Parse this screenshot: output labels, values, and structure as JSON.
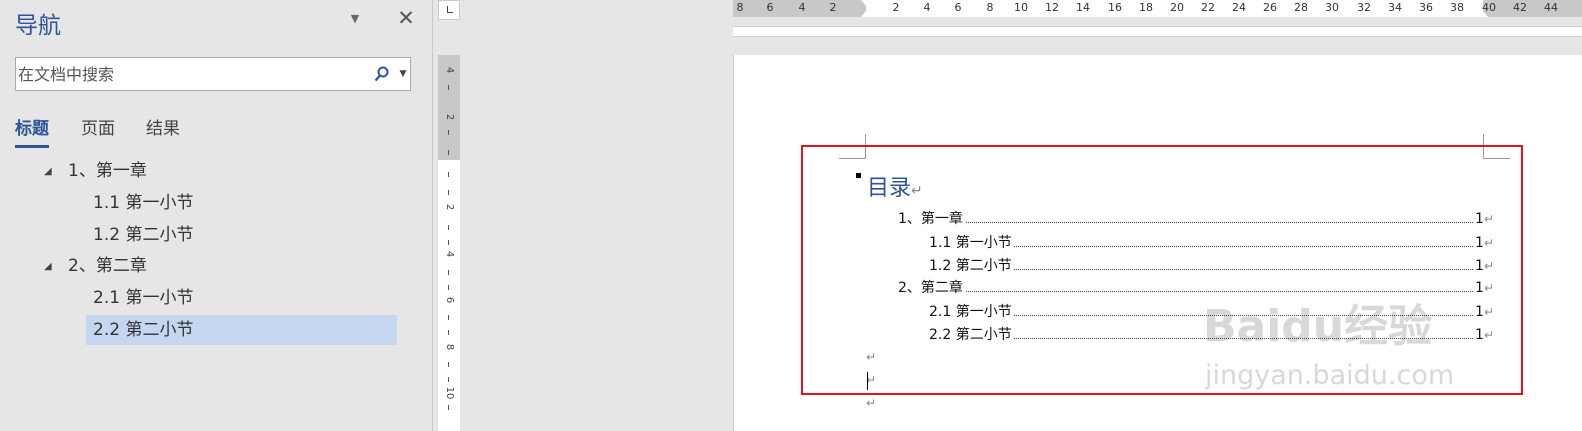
{
  "nav": {
    "title": "导航",
    "search_placeholder": "在文档中搜索",
    "tabs": [
      {
        "label": "标题"
      },
      {
        "label": "页面"
      },
      {
        "label": "结果"
      }
    ],
    "tree": [
      {
        "label": "1、第一章"
      },
      {
        "label": "1.1 第一小节"
      },
      {
        "label": "1.2 第二小节"
      },
      {
        "label": "2、第二章"
      },
      {
        "label": "2.1 第一小节"
      },
      {
        "label": "2.2 第二小节"
      }
    ]
  },
  "ruler": {
    "h_numbers": [
      "8",
      "6",
      "4",
      "2",
      "2",
      "4",
      "6",
      "8",
      "10",
      "12",
      "14",
      "16",
      "18",
      "20",
      "22",
      "24",
      "26",
      "28",
      "30",
      "32",
      "34",
      "36",
      "38",
      "40",
      "42",
      "44"
    ],
    "v_numbers": [
      "4",
      "2",
      "2",
      "4",
      "6",
      "8",
      "10"
    ]
  },
  "document": {
    "toc_title": "目录",
    "toc": [
      {
        "text": "1、第一章",
        "page": "1"
      },
      {
        "text": "1.1  第一小节",
        "page": "1"
      },
      {
        "text": "1.2  第二小节",
        "page": "1"
      },
      {
        "text": "2、第二章",
        "page": "1"
      },
      {
        "text": "2.1  第一小节",
        "page": "1"
      },
      {
        "text": "2.2  第二小节",
        "page": "1"
      }
    ],
    "paragraph_mark": "↵"
  },
  "watermark": {
    "logo": "Baidu经验",
    "url": "jingyan.baidu.com"
  },
  "colors": {
    "accent": "#2b579a",
    "selection": "#c5d7f0",
    "highlight_border": "#e0141e",
    "heading": "#2f5496"
  }
}
